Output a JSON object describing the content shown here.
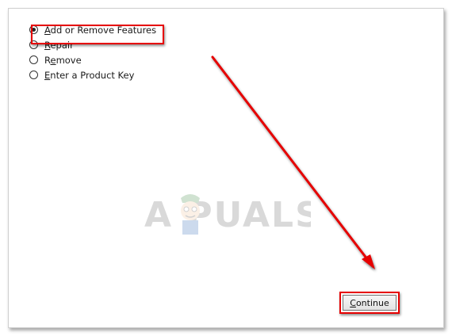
{
  "options": [
    {
      "label": "Add or Remove Features",
      "mnemonic": "A",
      "rest": "dd or Remove Features",
      "checked": true
    },
    {
      "label": "Repair",
      "mnemonic": "R",
      "rest": "epair",
      "checked": false
    },
    {
      "label": "Remove",
      "mnemonic": "e",
      "prefix": "R",
      "rest": "move",
      "checked": false
    },
    {
      "label": "Enter a Product Key",
      "mnemonic": "E",
      "rest": "nter a Product Key",
      "checked": false
    }
  ],
  "continue_button": {
    "mnemonic": "C",
    "rest": "ontinue"
  },
  "watermark": {
    "text": "A  PUALS"
  },
  "colors": {
    "highlight": "#e60000",
    "arrow": "#e60000"
  }
}
